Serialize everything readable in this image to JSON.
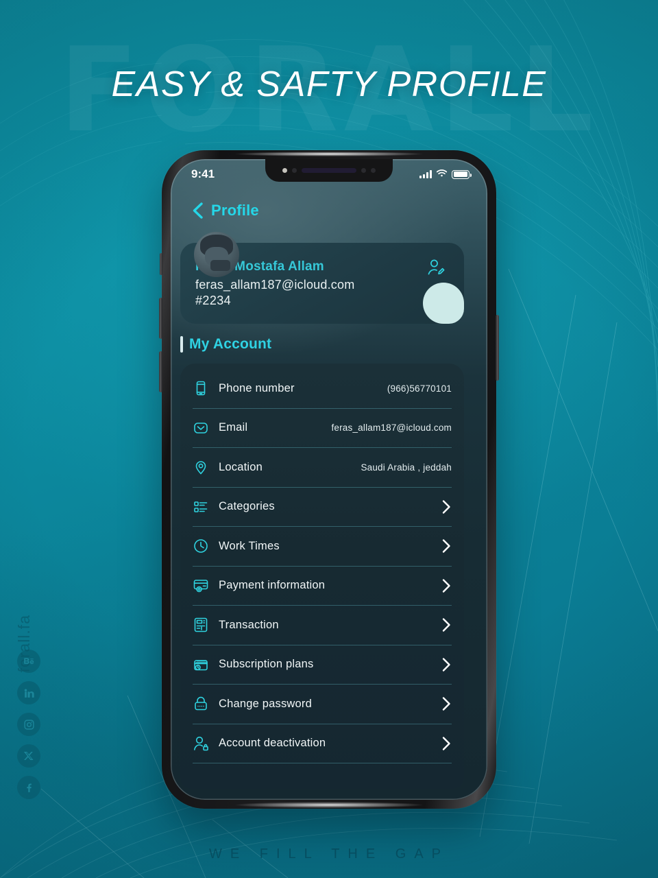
{
  "poster": {
    "headline": "EASY & SAFTY PROFILE",
    "watermark": "FORALL",
    "tagline": "WE FILL THE GAP",
    "handle": "forall.fa",
    "accent": "#2fd3e0",
    "background": "#0c8fa3",
    "socials": [
      {
        "name": "behance-icon",
        "glyph": "Bē"
      },
      {
        "name": "linkedin-icon",
        "glyph": "in"
      },
      {
        "name": "instagram-icon",
        "glyph": "◉"
      },
      {
        "name": "x-twitter-icon",
        "glyph": "✕"
      },
      {
        "name": "facebook-icon",
        "glyph": "f"
      }
    ]
  },
  "statusbar": {
    "time": "9:41",
    "signal_icon": "cellular-bars-icon",
    "wifi_icon": "wifi-icon",
    "battery_icon": "battery-full-icon"
  },
  "navbar": {
    "back_icon": "chevron-left-icon",
    "title": "Profile"
  },
  "profile": {
    "name": "Feras Mostafa Allam",
    "email": "feras_allam187@icloud.com",
    "id": "#2234",
    "edit_icon": "edit-profile-icon",
    "avatar_icon": "avatar"
  },
  "section": {
    "title": "My Account"
  },
  "rows": [
    {
      "icon": "mobile-phone-icon",
      "label": "Phone number",
      "value": "(966)56770101",
      "chevron": false
    },
    {
      "icon": "envelope-icon",
      "label": "Email",
      "value": "feras_allam187@icloud.com",
      "chevron": false
    },
    {
      "icon": "location-pin-icon",
      "label": "Location",
      "value": "Saudi Arabia , jeddah",
      "chevron": false
    },
    {
      "icon": "categories-list-icon",
      "label": "Categories",
      "value": "",
      "chevron": true
    },
    {
      "icon": "clock-icon",
      "label": "Work Times",
      "value": "",
      "chevron": true
    },
    {
      "icon": "credit-card-lock-icon",
      "label": "Payment information",
      "value": "",
      "chevron": true
    },
    {
      "icon": "atm-receipt-icon",
      "label": "Transaction",
      "value": "",
      "chevron": true
    },
    {
      "icon": "subscription-cards-icon",
      "label": "Subscription plans",
      "value": "",
      "chevron": true
    },
    {
      "icon": "padlock-icon",
      "label": "Change password",
      "value": "",
      "chevron": true
    },
    {
      "icon": "user-lock-icon",
      "label": "Account deactivation",
      "value": "",
      "chevron": true
    }
  ]
}
